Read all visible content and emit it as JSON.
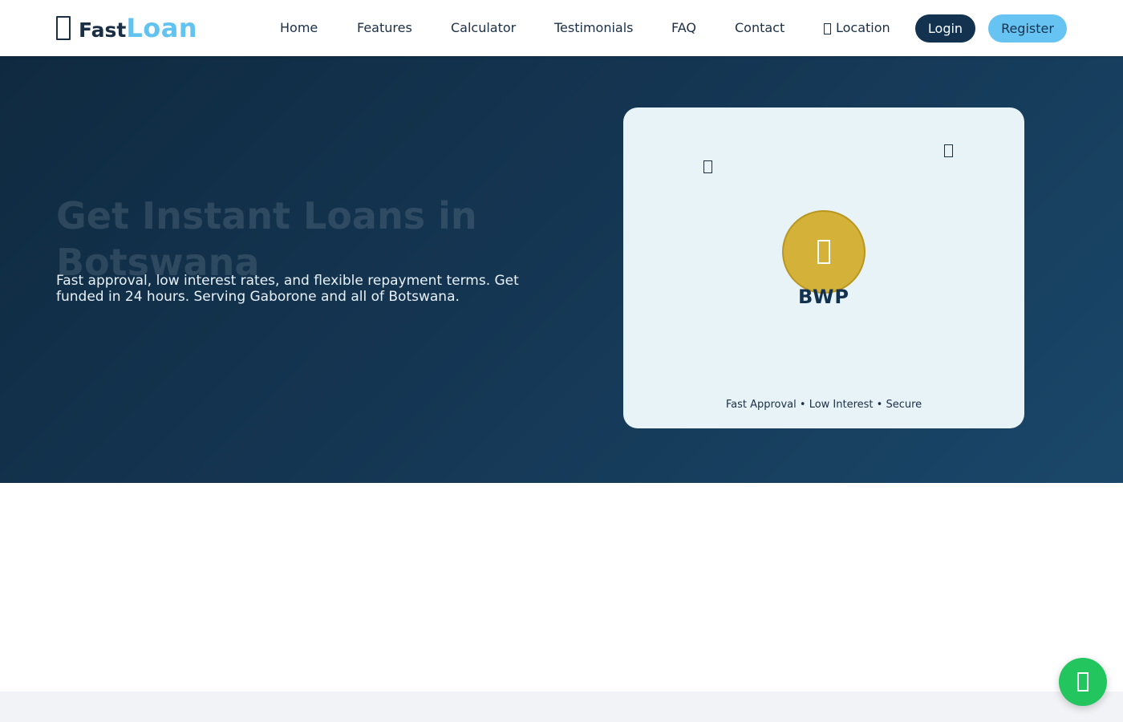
{
  "brand": {
    "name_part1": "Fast",
    "name_part2": "Loan",
    "colors": {
      "primary": "#13324f",
      "accent": "#67c4f2",
      "gold": "#d4b23a",
      "whatsapp": "#22c55e"
    },
    "logo_icon": "hand-holding-dollar-icon"
  },
  "nav": {
    "links": [
      "Home",
      "Features",
      "Calculator",
      "Testimonials",
      "FAQ",
      "Contact"
    ],
    "location_label": "Location",
    "location_icon": "map-pin-icon",
    "login_label": "Login",
    "register_label": "Register"
  },
  "hero": {
    "title": "Get Instant Loans in Botswana",
    "subtitle": "Fast approval, low interest rates, and flexible repayment terms. Get funded in 24 hours. Serving Gaborone and all of Botswana.",
    "card": {
      "currency": "BWP",
      "tagline": "Fast Approval • Low Interest • Secure",
      "coin_icon": "coins-icon",
      "float_icons": [
        "money-bill-icon",
        "chart-line-icon"
      ]
    }
  },
  "chat": {
    "icon": "whatsapp-icon"
  }
}
